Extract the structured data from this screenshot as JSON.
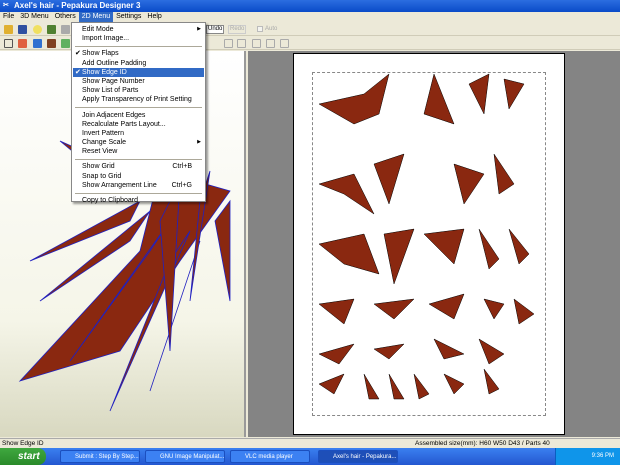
{
  "window": {
    "title": "Axel's hair - Pepakura Designer 3"
  },
  "menubar": [
    "File",
    "3D Menu",
    "Others",
    "2D Menu",
    "Settings",
    "Help"
  ],
  "toolbar": {
    "undo": "Undo",
    "redo": "Redo",
    "auto": "Auto"
  },
  "menu_2d": {
    "group1": [
      {
        "label": "Edit Mode",
        "submenu": true
      },
      {
        "label": "Import Image..."
      }
    ],
    "group2": [
      {
        "label": "Show Flaps",
        "checked": true
      },
      {
        "label": "Add Outline Padding"
      },
      {
        "label": "Show Edge ID",
        "checked": true,
        "highlighted": true
      },
      {
        "label": "Show Page Number"
      },
      {
        "label": "Show List of Parts"
      },
      {
        "label": "Apply Transparency of Print Setting"
      }
    ],
    "group3": [
      {
        "label": "Join Adjacent Edges"
      },
      {
        "label": "Recalculate Parts Layout..."
      },
      {
        "label": "Invert Pattern"
      },
      {
        "label": "Change Scale",
        "submenu": true
      },
      {
        "label": "Reset View"
      }
    ],
    "group4": [
      {
        "label": "Show Grid",
        "shortcut": "Ctrl+B"
      },
      {
        "label": "Snap to Grid"
      },
      {
        "label": "Show Arrangement Line",
        "shortcut": "Ctrl+G"
      }
    ],
    "group5": [
      {
        "label": "Copy to Clipboard"
      }
    ]
  },
  "status": {
    "left": "Show Edge ID",
    "right": "Assembled size(mm): H60 W50 D43 / Parts 40"
  },
  "taskbar": {
    "start": "start",
    "tasks": [
      "Submit : Step By Step...",
      "GNU Image Manipulat...",
      "VLC media player",
      "Axel's hair - Pepakura..."
    ],
    "clock": "9:36 PM"
  }
}
